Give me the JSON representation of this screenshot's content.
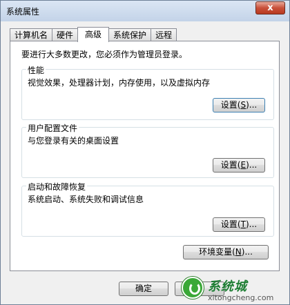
{
  "window": {
    "title": "系统属性",
    "close_symbol": "x"
  },
  "tabs": [
    {
      "label": "计算机名",
      "active": false
    },
    {
      "label": "硬件",
      "active": false
    },
    {
      "label": "高级",
      "active": true
    },
    {
      "label": "系统保护",
      "active": false
    },
    {
      "label": "远程",
      "active": false
    }
  ],
  "panel": {
    "notice": "要进行大多数更改，您必须作为管理员登录。",
    "performance": {
      "title": "性能",
      "desc": "视觉效果，处理器计划，内存使用，以及虚拟内存",
      "button_label": "设置",
      "button_hotkey": "S",
      "button_suffix": "..."
    },
    "user_profiles": {
      "title": "用户配置文件",
      "desc": "与您登录有关的桌面设置",
      "button_label": "设置",
      "button_hotkey": "E",
      "button_suffix": "..."
    },
    "startup_recovery": {
      "title": "启动和故障恢复",
      "desc": "系统启动、系统失败和调试信息",
      "button_label": "设置",
      "button_hotkey": "T",
      "button_suffix": "..."
    },
    "env_vars": {
      "label": "环境变量",
      "hotkey": "N",
      "suffix": "..."
    }
  },
  "footer": {
    "ok_label": "确定"
  },
  "watermark": {
    "brand": "系统城",
    "url": "xitongcheng.com",
    "color": "#1e7e34"
  }
}
